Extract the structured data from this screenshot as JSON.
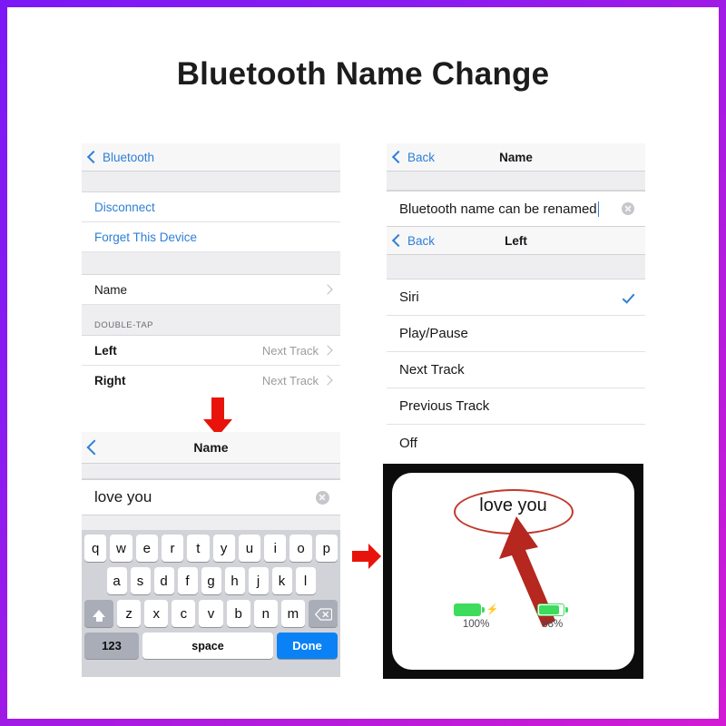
{
  "page": {
    "title": "Bluetooth Name Change",
    "border_color_start": "#7b18f5",
    "border_color_end": "#d21ad4"
  },
  "panel_device_settings": {
    "nav": {
      "back_label": "Bluetooth",
      "title": ""
    },
    "rows": [
      {
        "label": "Disconnect",
        "style": "link",
        "value": "",
        "chevron": false
      },
      {
        "label": "Forget This Device",
        "style": "link",
        "value": "",
        "chevron": false
      }
    ],
    "name_row": {
      "label": "Name",
      "value": "",
      "chevron": true
    },
    "section_header": "DOUBLE-TAP",
    "double_tap_rows": [
      {
        "label": "Left",
        "value": "Next Track",
        "chevron": true
      },
      {
        "label": "Right",
        "value": "Next Track",
        "chevron": true
      }
    ]
  },
  "panel_name_edit": {
    "nav": {
      "back_label": "Back",
      "title": "Name"
    },
    "field": {
      "value": "Bluetooth name can be renamed",
      "clear_icon": "clear-circle-icon"
    },
    "nav2": {
      "back_label": "Back",
      "title": "Left"
    }
  },
  "panel_left_options": {
    "options": [
      {
        "label": "Siri",
        "selected": true
      },
      {
        "label": "Play/Pause",
        "selected": false
      },
      {
        "label": "Next Track",
        "selected": false
      },
      {
        "label": "Previous Track",
        "selected": false
      },
      {
        "label": "Off",
        "selected": false
      }
    ],
    "check_icon": "checkmark-icon",
    "accent_color": "#2e7fd6"
  },
  "panel_keyboard": {
    "nav": {
      "back_label": "",
      "title": "Name"
    },
    "field": {
      "value": "love you",
      "clear_icon": "clear-circle-icon"
    },
    "keyboard": {
      "row1": [
        "q",
        "w",
        "e",
        "r",
        "t",
        "y",
        "u",
        "i",
        "o",
        "p"
      ],
      "row2": [
        "a",
        "s",
        "d",
        "f",
        "g",
        "h",
        "j",
        "k",
        "l"
      ],
      "row3": [
        "z",
        "x",
        "c",
        "v",
        "b",
        "n",
        "m"
      ],
      "shift_label": "",
      "backspace_label": "",
      "num_label": "123",
      "space_label": "space",
      "done_label": "Done",
      "done_color": "#0a82f5"
    }
  },
  "photo_result": {
    "device_name": "love you",
    "batteries": [
      {
        "percent": "100%",
        "charging": true
      },
      {
        "percent": "88%",
        "charging": false
      }
    ],
    "annotation_color": "#b5271f"
  },
  "arrows": {
    "down_arrow": "arrow-down-icon",
    "right_arrow": "arrow-right-icon",
    "color": "#e8140b"
  }
}
